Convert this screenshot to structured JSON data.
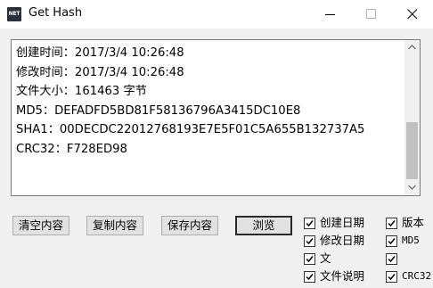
{
  "window": {
    "icon_text": "NET",
    "title": "Get Hash"
  },
  "output": {
    "lines": [
      "创建时间：2017/3/4 10:26:48",
      "修改时间：2017/3/4 10:26:48",
      "文件大小：161463 字节",
      "MD5：DEFADFD5BD81F58136796A3415DC10E8",
      "SHA1：00DECDC22012768193E7E5F01C5A655B132737A5",
      "CRC32：F728ED98"
    ]
  },
  "buttons": {
    "clear": "清空内容",
    "copy": "复制内容",
    "save": "保存内容",
    "browse": "浏览"
  },
  "options": {
    "create_date": {
      "label": "创建日期",
      "checked": true
    },
    "modify_date": {
      "label": "修改日期",
      "checked": true
    },
    "file_size": {
      "label": "文",
      "checked": true
    },
    "file_desc": {
      "label": "文件说明",
      "checked": true
    },
    "version": {
      "label": "版本",
      "checked": true
    },
    "md5": {
      "label": "MD5",
      "checked": true
    },
    "sha1": {
      "label": "",
      "checked": true
    },
    "crc32": {
      "label": "CRC32",
      "checked": true
    }
  },
  "icons": {
    "app": "app-icon",
    "minimize": "minimize-icon",
    "maximize": "maximize-icon",
    "close": "close-icon",
    "scroll_up": "scroll-up-arrow-icon",
    "scroll_down": "scroll-down-arrow-icon",
    "check": "checkmark-icon"
  },
  "colors": {
    "window_bg": "#f0f0f0",
    "titlebar_bg": "#ffffff",
    "button_bg": "#e1e1e1",
    "scroll_thumb": "#c0c0c0"
  }
}
